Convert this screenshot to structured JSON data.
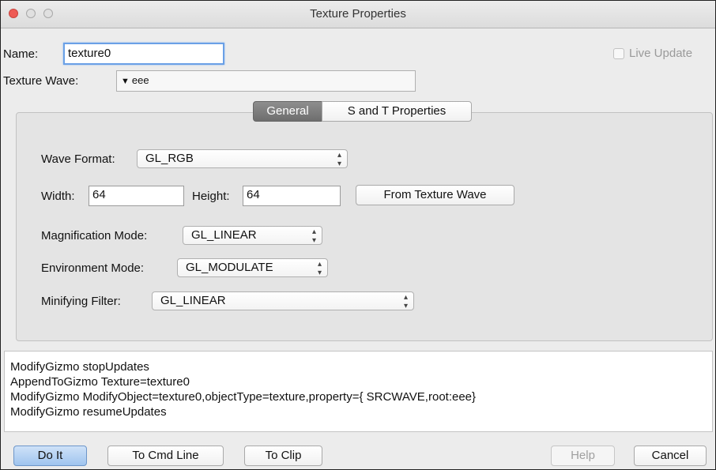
{
  "window": {
    "title": "Texture Properties"
  },
  "form": {
    "name_label": "Name:",
    "name_value": "texture0",
    "live_update_label": "Live Update",
    "texture_wave_label": "Texture Wave:",
    "texture_wave_value": "eee"
  },
  "tabs": [
    {
      "label": "General",
      "selected": true
    },
    {
      "label": "S and T Properties",
      "selected": false
    }
  ],
  "general": {
    "wave_format_label": "Wave Format:",
    "wave_format_value": "GL_RGB",
    "width_label": "Width:",
    "width_value": "64",
    "height_label": "Height:",
    "height_value": "64",
    "from_texture_wave_label": "From Texture Wave",
    "magnification_label": "Magnification Mode:",
    "magnification_value": "GL_LINEAR",
    "environment_label": "Environment Mode:",
    "environment_value": "GL_MODULATE",
    "minifying_label": "Minifying Filter:",
    "minifying_value": "GL_LINEAR"
  },
  "commands": [
    "ModifyGizmo stopUpdates",
    "AppendToGizmo Texture=texture0",
    "ModifyGizmo ModifyObject=texture0,objectType=texture,property={ SRCWAVE,root:eee}",
    "ModifyGizmo resumeUpdates"
  ],
  "buttons": {
    "do_it": "Do It",
    "to_cmd_line": "To Cmd Line",
    "to_clip": "To Clip",
    "help": "Help",
    "cancel": "Cancel"
  },
  "colors": {
    "close_button": "#ee5b55",
    "selected_tab": "#7a7a7a",
    "default_button": "#9fc4ee",
    "focus_ring": "#6aa0e6"
  }
}
